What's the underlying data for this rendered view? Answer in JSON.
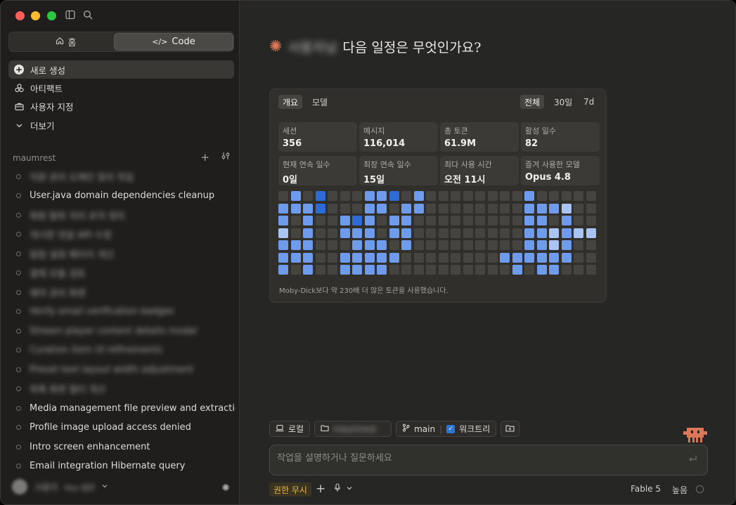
{
  "sidebar": {
    "segmented": {
      "home_icon": "home-icon",
      "home_label": "홈",
      "code_label": "Code"
    },
    "nav": [
      {
        "label": "새로 생성",
        "icon": "plus-icon"
      },
      {
        "label": "아티팩트",
        "icon": "artifact-icon"
      },
      {
        "label": "사용자 지정",
        "icon": "briefcase-icon"
      },
      {
        "label": "더보기",
        "icon": "chevron-down-icon"
      }
    ],
    "section_title": "maumrest",
    "sessions": [
      {
        "title": "직원 관리 도메인 정리 작업",
        "blurred": true
      },
      {
        "title": "User.java domain dependencies cleanup",
        "blurred": false
      },
      {
        "title": "회원 탈퇴 처리 로직 정리",
        "blurred": true
      },
      {
        "title": "게시판 댓글 API 수정",
        "blurred": true
      },
      {
        "title": "알림 설정 페이지 개선",
        "blurred": true
      },
      {
        "title": "결제 모듈 검토",
        "blurred": true
      },
      {
        "title": "예약 관리 화면",
        "blurred": true
      },
      {
        "title": "Verify email verification badges",
        "blurred": true
      },
      {
        "title": "Stream player content details modal",
        "blurred": true
      },
      {
        "title": "Curation item UI refinements",
        "blurred": true
      },
      {
        "title": "Preset text layout width adjustment",
        "blurred": true
      },
      {
        "title": "목록 화면 필터 개선",
        "blurred": true
      },
      {
        "title": "Media management file preview and extraction",
        "blurred": false
      },
      {
        "title": "Profile image upload access denied",
        "blurred": false
      },
      {
        "title": "Intro screen enhancement",
        "blurred": false
      },
      {
        "title": "Email integration Hibernate query",
        "blurred": false
      }
    ],
    "user": {
      "name": "사용자",
      "plan": "Max 플랜"
    }
  },
  "main": {
    "greeting_name": "사용자님",
    "greeting_text": "다음 일정은 무엇인가요?",
    "stats": {
      "tabs_left": [
        "개요",
        "모델"
      ],
      "tabs_right": [
        "전체",
        "30일",
        "7d"
      ],
      "cards": [
        {
          "label": "세션",
          "value": "356"
        },
        {
          "label": "메시지",
          "value": "116,014"
        },
        {
          "label": "총 토큰",
          "value": "61.9M"
        },
        {
          "label": "활성 일수",
          "value": "82"
        },
        {
          "label": "현재 연속 일수",
          "value": "0일"
        },
        {
          "label": "최장 연속 일수",
          "value": "15일"
        },
        {
          "label": "최다 사용 시간",
          "value": "오전 11시"
        },
        {
          "label": "즐겨 사용한 모델",
          "value": "Opus 4.8"
        }
      ],
      "heatmap": [
        [
          0,
          2,
          0,
          3,
          0,
          0,
          0,
          2,
          2,
          3,
          0,
          2,
          0,
          0,
          0,
          0,
          0,
          0,
          0,
          0,
          2,
          0,
          0,
          0,
          0,
          0
        ],
        [
          2,
          2,
          2,
          3,
          0,
          0,
          0,
          2,
          2,
          0,
          2,
          2,
          0,
          0,
          0,
          0,
          0,
          0,
          0,
          0,
          2,
          2,
          2,
          1,
          0,
          0
        ],
        [
          2,
          0,
          2,
          0,
          0,
          2,
          3,
          2,
          0,
          2,
          2,
          0,
          0,
          0,
          0,
          0,
          0,
          0,
          0,
          0,
          2,
          2,
          0,
          2,
          0,
          0
        ],
        [
          1,
          0,
          2,
          0,
          0,
          2,
          2,
          2,
          0,
          2,
          2,
          0,
          0,
          0,
          0,
          0,
          0,
          0,
          0,
          0,
          2,
          2,
          1,
          2,
          1,
          1
        ],
        [
          2,
          2,
          2,
          0,
          0,
          0,
          2,
          2,
          2,
          0,
          2,
          0,
          0,
          0,
          0,
          0,
          0,
          0,
          0,
          0,
          2,
          2,
          1,
          2,
          0,
          0
        ],
        [
          2,
          2,
          2,
          0,
          0,
          2,
          2,
          2,
          2,
          2,
          0,
          0,
          0,
          0,
          0,
          0,
          0,
          0,
          2,
          2,
          2,
          2,
          2,
          2,
          0,
          0
        ],
        [
          2,
          0,
          2,
          0,
          0,
          2,
          2,
          2,
          2,
          0,
          0,
          0,
          0,
          0,
          0,
          0,
          0,
          0,
          0,
          2,
          0,
          2,
          2,
          0,
          0,
          0
        ]
      ],
      "footnote": "Moby-Dick보다 약 230배 더 많은 토큰을 사용했습니다.",
      "colors": {
        "empty": "#45443f",
        "light": "#a9c4f3",
        "mid": "#6f9bec",
        "dark": "#2f6bd6"
      }
    },
    "toolbar": {
      "local_label": "로컬",
      "folder_label": "maumrest",
      "branch_label": "main",
      "worktree_label": "워크트리"
    },
    "composer": {
      "placeholder": "작업을 설명하거나 질문하세요"
    },
    "bottom": {
      "permission_label": "권한 무시",
      "model_label": "Fable 5",
      "effort_label": "높음"
    }
  }
}
